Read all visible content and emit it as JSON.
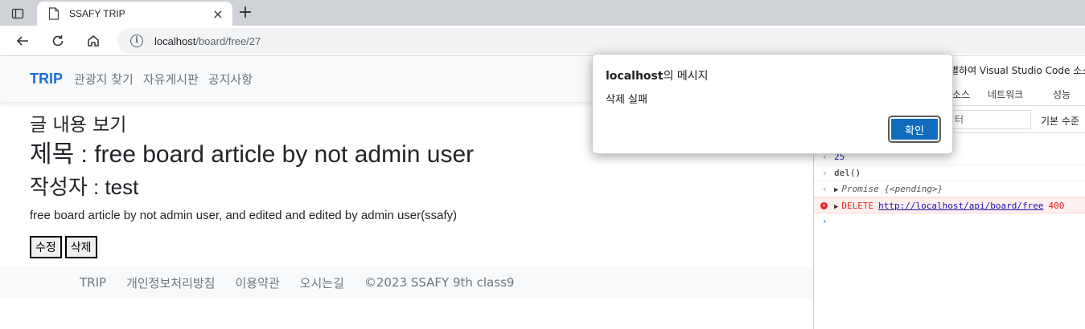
{
  "browser": {
    "tab_title": "SSAFY TRIP",
    "tab_close": "×",
    "newtab": "+",
    "url_host": "localhost",
    "url_path": "/board/free/27"
  },
  "page": {
    "brand": "TRIP",
    "nav": [
      "관광지 찾기",
      "자유게시판",
      "공지사항"
    ],
    "sub_heading": "글 내용 보기",
    "title_line": "제목 : free board article by not admin user",
    "author_line": "작성자 : test",
    "body": "free board article by not admin user, and edited and edited by admin user(ssafy)",
    "edit_button": "수정",
    "delete_button": "삭제",
    "footer": [
      "TRIP",
      "개인정보처리방침",
      "이용약관",
      "오시는길",
      "©2023 SSAFY 9th class9"
    ]
  },
  "devtools": {
    "banner": "별하여 Visual Studio Code 소스",
    "tab_sources": "소스",
    "tab_network": "네트워크",
    "tab_performance": "성능",
    "filter_placeholder": "터",
    "levels": "기본 수준",
    "console": {
      "line1_value": "25",
      "line2_input": "del()",
      "line3_promise": "Promise {<pending>}",
      "line4_method": "DELETE",
      "line4_url": "http://localhost/api/board/free",
      "line4_status": "400",
      "prompt": "›"
    }
  },
  "dialog": {
    "title_host": "localhost",
    "title_suffix": "의 메시지",
    "message": "삭제 실패",
    "ok_label": "확인"
  },
  "colors": {
    "brand": "#1a6fe0",
    "dialog_button": "#0f6cbd",
    "console_error": "#e02424"
  }
}
